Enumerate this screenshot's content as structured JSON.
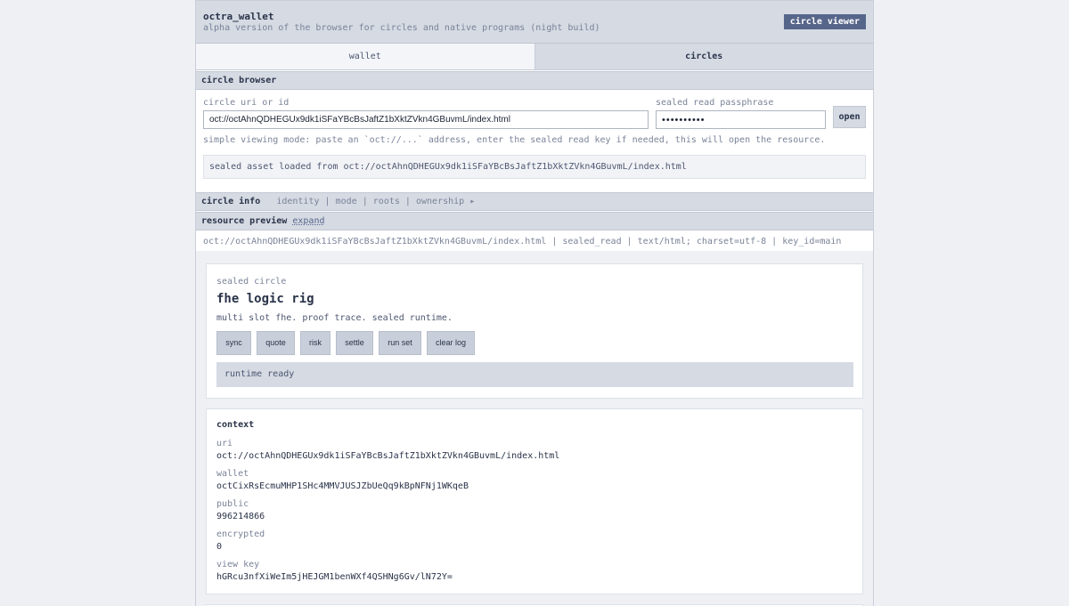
{
  "header": {
    "title": "octra_wallet",
    "subtitle": "alpha version of the browser for circles and native programs (night build)",
    "badge": "circle viewer"
  },
  "tabs": [
    {
      "label": "wallet",
      "active": false
    },
    {
      "label": "circles",
      "active": true
    }
  ],
  "browser": {
    "section_title": "circle browser",
    "uri_label": "circle uri or id",
    "uri_value": "oct://octAhnQDHEGUx9dk1iSFaYBcBsJaftZ1bXktZVkn4GBuvmL/index.html",
    "pass_label": "sealed read passphrase",
    "pass_value": "••••••••••",
    "open_label": "open",
    "hint": "simple viewing mode: paste an `oct://...` address, enter the sealed read key if needed, this will open the resource.",
    "status": "sealed asset loaded from oct://octAhnQDHEGUx9dk1iSFaYBcBsJaftZ1bXktZVkn4GBuvmL/index.html"
  },
  "info": {
    "title": "circle info",
    "items": [
      "identity",
      "mode",
      "roots",
      "ownership"
    ],
    "separator": "|",
    "arrow": "▸"
  },
  "preview": {
    "title": "resource preview",
    "expand": "expand",
    "meta": "oct://octAhnQDHEGUx9dk1iSFaYBcBsJaftZ1bXktZVkn4GBuvmL/index.html | sealed_read | text/html; charset=utf-8 | key_id=main"
  },
  "circle_card": {
    "label": "sealed circle",
    "title": "fhe logic rig",
    "subtitle": "multi slot fhe. proof trace. sealed runtime.",
    "buttons": [
      "sync",
      "quote",
      "risk",
      "settle",
      "run set",
      "clear log"
    ],
    "log": "runtime ready"
  },
  "context": {
    "title": "context",
    "rows": [
      {
        "key": "uri",
        "value": "oct://octAhnQDHEGUx9dk1iSFaYBcBsJaftZ1bXktZVkn4GBuvmL/index.html"
      },
      {
        "key": "wallet",
        "value": "octCixRsEcmuMHP1SHc4MMVJUSJZbUeQq9kBpNFNj1WKqeB"
      },
      {
        "key": "public",
        "value": "996214866"
      },
      {
        "key": "encrypted",
        "value": "0"
      },
      {
        "key": "view key",
        "value": "hGRcu3nfXiWeIm5jHEJGM1benWXf4QSHNg6Gv/lN72Y="
      }
    ]
  },
  "colors": {
    "accent": "#56658a",
    "bar": "#d5dae3",
    "page": "#eef0f4"
  }
}
